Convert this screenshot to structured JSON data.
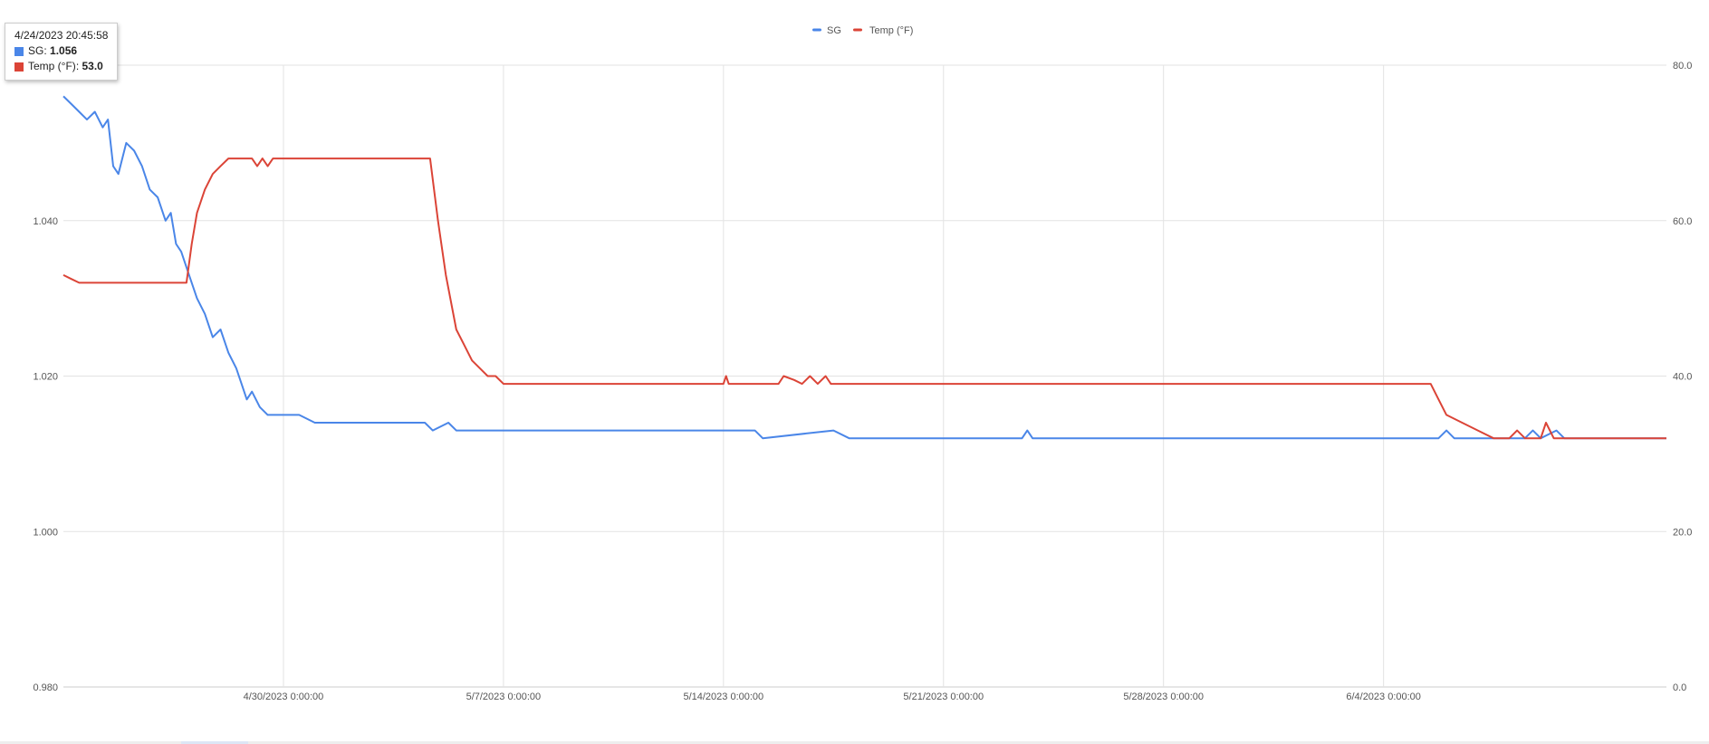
{
  "chart_data": {
    "type": "line",
    "title": "",
    "legend": {
      "position": "top-center",
      "entries": [
        "SG",
        "Temp (°F)"
      ]
    },
    "grid": true,
    "x_axis": {
      "type": "date",
      "range": [
        "2023-04-23T00:00:00",
        "2023-06-13T00:00:00"
      ],
      "ticks": [
        {
          "x": "2023-04-30T00:00:00",
          "label": "4/30/2023 0:00:00"
        },
        {
          "x": "2023-05-07T00:00:00",
          "label": "5/7/2023 0:00:00"
        },
        {
          "x": "2023-05-14T00:00:00",
          "label": "5/14/2023 0:00:00"
        },
        {
          "x": "2023-05-21T00:00:00",
          "label": "5/21/2023 0:00:00"
        },
        {
          "x": "2023-05-28T00:00:00",
          "label": "5/28/2023 0:00:00"
        },
        {
          "x": "2023-06-04T00:00:00",
          "label": "6/4/2023 0:00:00"
        }
      ]
    },
    "y_axis_left": {
      "range": [
        0.98,
        1.06
      ],
      "ticks": [
        {
          "y": 0.98,
          "label": "0.980"
        },
        {
          "y": 1.0,
          "label": "1.000"
        },
        {
          "y": 1.02,
          "label": "1.020"
        },
        {
          "y": 1.04,
          "label": "1.040"
        }
      ]
    },
    "y_axis_right": {
      "range": [
        0,
        80
      ],
      "ticks": [
        {
          "y": 0,
          "label": "0.0"
        },
        {
          "y": 20,
          "label": "20.0"
        },
        {
          "y": 40,
          "label": "40.0"
        },
        {
          "y": 60,
          "label": "60.0"
        },
        {
          "y": 80,
          "label": "80.0"
        }
      ]
    },
    "series": [
      {
        "name": "SG",
        "axis": "left",
        "color": "#4a86e8",
        "points": [
          [
            "2023-04-23T00:00:00",
            1.056
          ],
          [
            "2023-04-23T06:00:00",
            1.055
          ],
          [
            "2023-04-23T12:00:00",
            1.054
          ],
          [
            "2023-04-23T18:00:00",
            1.053
          ],
          [
            "2023-04-24T00:00:00",
            1.054
          ],
          [
            "2023-04-24T06:00:00",
            1.052
          ],
          [
            "2023-04-24T10:00:00",
            1.053
          ],
          [
            "2023-04-24T14:00:00",
            1.047
          ],
          [
            "2023-04-24T18:00:00",
            1.046
          ],
          [
            "2023-04-25T00:00:00",
            1.05
          ],
          [
            "2023-04-25T06:00:00",
            1.049
          ],
          [
            "2023-04-25T12:00:00",
            1.047
          ],
          [
            "2023-04-25T18:00:00",
            1.044
          ],
          [
            "2023-04-26T00:00:00",
            1.043
          ],
          [
            "2023-04-26T06:00:00",
            1.04
          ],
          [
            "2023-04-26T10:00:00",
            1.041
          ],
          [
            "2023-04-26T14:00:00",
            1.037
          ],
          [
            "2023-04-26T18:00:00",
            1.036
          ],
          [
            "2023-04-27T00:00:00",
            1.033
          ],
          [
            "2023-04-27T06:00:00",
            1.03
          ],
          [
            "2023-04-27T12:00:00",
            1.028
          ],
          [
            "2023-04-27T18:00:00",
            1.025
          ],
          [
            "2023-04-28T00:00:00",
            1.026
          ],
          [
            "2023-04-28T06:00:00",
            1.023
          ],
          [
            "2023-04-28T12:00:00",
            1.021
          ],
          [
            "2023-04-28T16:00:00",
            1.019
          ],
          [
            "2023-04-28T20:00:00",
            1.017
          ],
          [
            "2023-04-29T00:00:00",
            1.018
          ],
          [
            "2023-04-29T06:00:00",
            1.016
          ],
          [
            "2023-04-29T12:00:00",
            1.015
          ],
          [
            "2023-04-30T00:00:00",
            1.015
          ],
          [
            "2023-04-30T12:00:00",
            1.015
          ],
          [
            "2023-05-01T00:00:00",
            1.014
          ],
          [
            "2023-05-04T12:00:00",
            1.014
          ],
          [
            "2023-05-04T18:00:00",
            1.013
          ],
          [
            "2023-05-05T06:00:00",
            1.014
          ],
          [
            "2023-05-05T12:00:00",
            1.013
          ],
          [
            "2023-05-15T00:00:00",
            1.013
          ],
          [
            "2023-05-15T06:00:00",
            1.012
          ],
          [
            "2023-05-17T12:00:00",
            1.013
          ],
          [
            "2023-05-18T00:00:00",
            1.012
          ],
          [
            "2023-05-23T12:00:00",
            1.012
          ],
          [
            "2023-05-23T16:00:00",
            1.013
          ],
          [
            "2023-05-23T20:00:00",
            1.012
          ],
          [
            "2023-06-05T18:00:00",
            1.012
          ],
          [
            "2023-06-06T00:00:00",
            1.013
          ],
          [
            "2023-06-06T06:00:00",
            1.012
          ],
          [
            "2023-06-08T12:00:00",
            1.012
          ],
          [
            "2023-06-08T18:00:00",
            1.013
          ],
          [
            "2023-06-09T00:00:00",
            1.012
          ],
          [
            "2023-06-09T12:00:00",
            1.013
          ],
          [
            "2023-06-09T18:00:00",
            1.012
          ],
          [
            "2023-06-13T00:00:00",
            1.012
          ]
        ]
      },
      {
        "name": "Temp (°F)",
        "axis": "right",
        "color": "#db4437",
        "points": [
          [
            "2023-04-23T00:00:00",
            53
          ],
          [
            "2023-04-23T06:00:00",
            52.5
          ],
          [
            "2023-04-23T12:00:00",
            52
          ],
          [
            "2023-04-26T18:00:00",
            52
          ],
          [
            "2023-04-26T22:00:00",
            52
          ],
          [
            "2023-04-27T02:00:00",
            57
          ],
          [
            "2023-04-27T06:00:00",
            61
          ],
          [
            "2023-04-27T12:00:00",
            64
          ],
          [
            "2023-04-27T18:00:00",
            66
          ],
          [
            "2023-04-28T00:00:00",
            67
          ],
          [
            "2023-04-28T06:00:00",
            68
          ],
          [
            "2023-04-29T00:00:00",
            68
          ],
          [
            "2023-04-29T04:00:00",
            67
          ],
          [
            "2023-04-29T08:00:00",
            68
          ],
          [
            "2023-04-29T12:00:00",
            67
          ],
          [
            "2023-04-29T16:00:00",
            68
          ],
          [
            "2023-05-04T12:00:00",
            68
          ],
          [
            "2023-05-04T16:00:00",
            68
          ],
          [
            "2023-05-04T22:00:00",
            60
          ],
          [
            "2023-05-05T04:00:00",
            53
          ],
          [
            "2023-05-05T12:00:00",
            46
          ],
          [
            "2023-05-05T18:00:00",
            44
          ],
          [
            "2023-05-06T00:00:00",
            42
          ],
          [
            "2023-05-06T06:00:00",
            41
          ],
          [
            "2023-05-06T12:00:00",
            40
          ],
          [
            "2023-05-06T18:00:00",
            40
          ],
          [
            "2023-05-07T00:00:00",
            39
          ],
          [
            "2023-05-14T00:00:00",
            39
          ],
          [
            "2023-05-14T02:00:00",
            40
          ],
          [
            "2023-05-14T04:00:00",
            39
          ],
          [
            "2023-05-15T18:00:00",
            39
          ],
          [
            "2023-05-15T22:00:00",
            40
          ],
          [
            "2023-05-16T06:00:00",
            39.5
          ],
          [
            "2023-05-16T12:00:00",
            39
          ],
          [
            "2023-05-16T18:00:00",
            40
          ],
          [
            "2023-05-17T00:00:00",
            39
          ],
          [
            "2023-05-17T06:00:00",
            40
          ],
          [
            "2023-05-17T10:00:00",
            39
          ],
          [
            "2023-06-04T12:00:00",
            39
          ],
          [
            "2023-06-05T12:00:00",
            39
          ],
          [
            "2023-06-05T18:00:00",
            37
          ],
          [
            "2023-06-06T00:00:00",
            35
          ],
          [
            "2023-06-06T12:00:00",
            34
          ],
          [
            "2023-06-07T00:00:00",
            33
          ],
          [
            "2023-06-07T12:00:00",
            32
          ],
          [
            "2023-06-08T00:00:00",
            32
          ],
          [
            "2023-06-08T06:00:00",
            33
          ],
          [
            "2023-06-08T12:00:00",
            32
          ],
          [
            "2023-06-09T00:00:00",
            32
          ],
          [
            "2023-06-09T04:00:00",
            34
          ],
          [
            "2023-06-09T10:00:00",
            32
          ],
          [
            "2023-06-13T00:00:00",
            32
          ]
        ]
      }
    ]
  },
  "tooltip": {
    "date": "4/24/2023 20:45:58",
    "rows": [
      {
        "label": "SG",
        "value": "1.056",
        "color": "#4a86e8"
      },
      {
        "label": "Temp (°F)",
        "value": "53.0",
        "color": "#db4437"
      }
    ]
  }
}
